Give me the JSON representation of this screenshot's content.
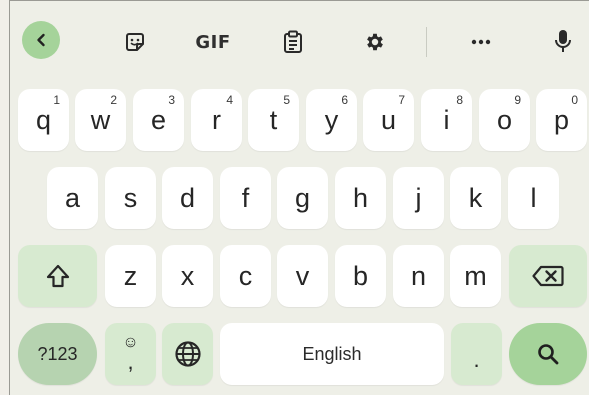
{
  "toolbar": {
    "gif_label": "GIF",
    "icons": [
      "back-chevron-icon",
      "sticker-icon",
      "gif",
      "clipboard-icon",
      "gear-icon",
      "more-icon",
      "microphone-icon"
    ]
  },
  "rows": [
    {
      "keys": [
        {
          "label": "q",
          "hint": "1"
        },
        {
          "label": "w",
          "hint": "2"
        },
        {
          "label": "e",
          "hint": "3"
        },
        {
          "label": "r",
          "hint": "4"
        },
        {
          "label": "t",
          "hint": "5"
        },
        {
          "label": "y",
          "hint": "6"
        },
        {
          "label": "u",
          "hint": "7"
        },
        {
          "label": "i",
          "hint": "8"
        },
        {
          "label": "o",
          "hint": "9"
        },
        {
          "label": "p",
          "hint": "0"
        }
      ]
    },
    {
      "keys": [
        {
          "label": "a"
        },
        {
          "label": "s"
        },
        {
          "label": "d"
        },
        {
          "label": "f"
        },
        {
          "label": "g"
        },
        {
          "label": "h"
        },
        {
          "label": "j"
        },
        {
          "label": "k"
        },
        {
          "label": "l"
        }
      ]
    },
    {
      "keys": [
        {
          "label": "z"
        },
        {
          "label": "x"
        },
        {
          "label": "c"
        },
        {
          "label": "v"
        },
        {
          "label": "b"
        },
        {
          "label": "n"
        },
        {
          "label": "m"
        }
      ]
    }
  ],
  "bottom": {
    "symbols_label": "?123",
    "emoji_glyph": "☺",
    "comma": ",",
    "space_label": "English",
    "period": "."
  },
  "colors": {
    "accent": "#a5d39a",
    "function_key": "#d7ead0",
    "background": "#eeefe7",
    "key": "#ffffff"
  }
}
